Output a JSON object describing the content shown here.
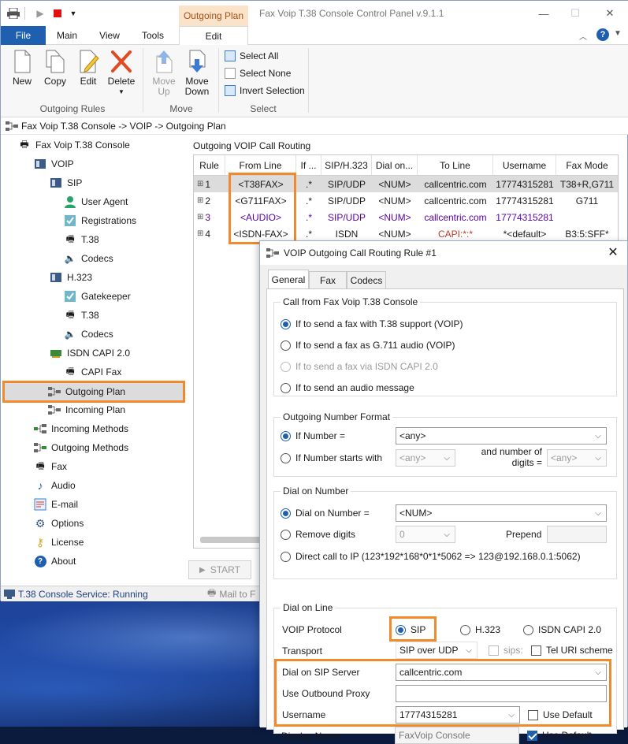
{
  "window": {
    "title": "Fax Voip T.38 Console Control Panel v.9.1.1",
    "context_tab": "Outgoing Plan"
  },
  "ribbon": {
    "tabs": [
      "File",
      "Main",
      "View",
      "Tools",
      "Edit"
    ],
    "outgoing_rules": {
      "label": "Outgoing Rules",
      "buttons": [
        "New",
        "Copy",
        "Edit",
        "Delete"
      ]
    },
    "move": {
      "label": "Move",
      "up_line1": "Move",
      "up_line2": "Up",
      "down_line1": "Move",
      "down_line2": "Down"
    },
    "select": {
      "label": "Select",
      "items": [
        "Select All",
        "Select None",
        "Invert Selection"
      ]
    }
  },
  "breadcrumb": "Fax Voip T.38 Console -> VOIP -> Outgoing Plan",
  "tree": [
    "Fax Voip T.38 Console",
    "VOIP",
    "SIP",
    "User Agent",
    "Registrations",
    "T.38",
    "Codecs",
    "H.323",
    "Gatekeeper",
    "T.38",
    "Codecs",
    "ISDN CAPI 2.0",
    "CAPI Fax",
    "Outgoing Plan",
    "Incoming Plan",
    "Incoming Methods",
    "Outgoing Methods",
    "Fax",
    "Audio",
    "E-mail",
    "Options",
    "License",
    "About"
  ],
  "routing": {
    "title": "Outgoing VOIP Call Routing",
    "columns": [
      "Rule",
      "From Line",
      "If ...",
      "SIP/H.323",
      "Dial on...",
      "To Line",
      "Username",
      "Fax Mode"
    ],
    "rows": [
      [
        "1",
        "<T38FAX>",
        ".*",
        "SIP/UDP",
        "<NUM>",
        "callcentric.com",
        "17774315281",
        "T38+R,G711"
      ],
      [
        "2",
        "<G711FAX>",
        ".*",
        "SIP/UDP",
        "<NUM>",
        "callcentric.com",
        "17774315281",
        "G711"
      ],
      [
        "3",
        "<AUDIO>",
        ".*",
        "SIP/UDP",
        "<NUM>",
        "callcentric.com",
        "17774315281",
        ""
      ],
      [
        "4",
        "<ISDN-FAX>",
        ".*",
        "ISDN",
        "<NUM>",
        "CAPI:*:*",
        "*<default>",
        "B3:5:SFF*"
      ]
    ],
    "start": "START",
    "mail_partial": "Mail to F"
  },
  "status": "T.38 Console Service: Running",
  "dialog": {
    "title": "VOIP Outgoing Call Routing Rule #1",
    "tabs": [
      "General",
      "Fax",
      "Codecs"
    ],
    "call_from": {
      "title": "Call from Fax Voip T.38 Console",
      "options": [
        "If to send a fax with T.38 support (VOIP)",
        "If to send a fax as G.711 audio (VOIP)",
        "If to send a fax via ISDN CAPI 2.0",
        "If to send an audio message"
      ]
    },
    "number_format": {
      "title": "Outgoing Number Format",
      "if_number": "If Number =",
      "if_number_value": "<any>",
      "starts_with": "If Number starts with",
      "starts_with_value": "<any>",
      "digits_label_1": "and number of",
      "digits_label_2": "digits =",
      "digits_value": "<any>"
    },
    "dial_on_number": {
      "title": "Dial on Number",
      "dial": "Dial on Number =",
      "dial_value": "<NUM>",
      "remove": "Remove digits",
      "remove_value": "0",
      "prepend": "Prepend",
      "direct": "Direct call to IP (123*192*168*0*1*5062 => 123@192.168.0.1:5062)"
    },
    "dial_on_line": {
      "title": "Dial on Line",
      "protocol_label": "VOIP Protocol",
      "protocols": [
        "SIP",
        "H.323",
        "ISDN CAPI 2.0"
      ],
      "transport_label": "Transport",
      "transport_value": "SIP over UDP",
      "sips": "sips:",
      "tel_uri": "Tel URI scheme",
      "server_label": "Dial on SIP Server",
      "server_value": "callcentric.com",
      "proxy_label": "Use Outbound Proxy",
      "username_label": "Username",
      "username_value": "17774315281",
      "use_default": "Use Default",
      "display_label": "Display Name",
      "display_value": "FaxVoip Console",
      "use_default_2": "Use Default"
    }
  },
  "colors": {
    "accent": "#1f5fb0",
    "highlight": "#f08a2c",
    "context_tab_bg": "#fbe3c9"
  }
}
